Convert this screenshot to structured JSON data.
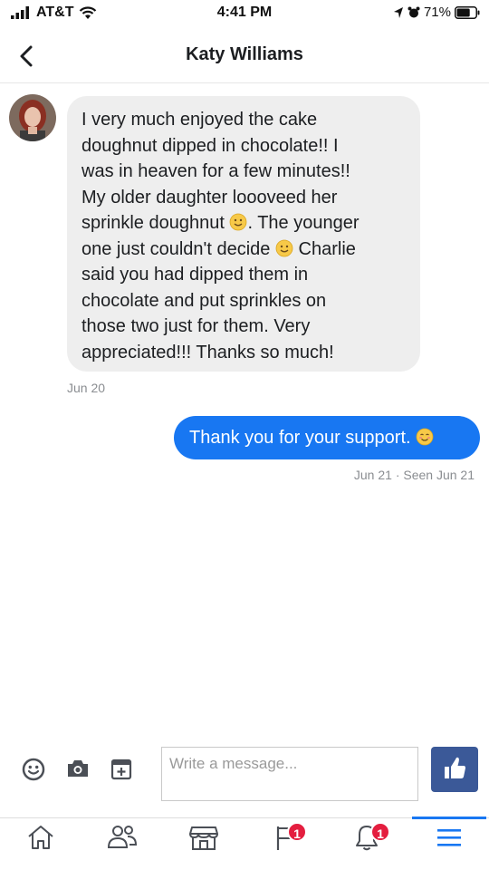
{
  "status_bar": {
    "carrier": "AT&T",
    "time": "4:41 PM",
    "battery_percent": "71%",
    "battery_level": 0.71
  },
  "header": {
    "title": "Katy Williams",
    "back_icon": "chevron-left-icon"
  },
  "conversation": {
    "incoming": {
      "lines_a": [
        "I very much enjoyed the cake",
        "doughnut dipped in chocolate!!  I",
        "was in heaven for a few minutes!!",
        "My older daughter loooveed her"
      ],
      "line5_before_emoji": "sprinkle doughnut ",
      "line5_after_emoji": ".  The younger",
      "line6_before_emoji": "one just couldn't decide ",
      "line6_after_emoji": " Charlie",
      "lines_b": [
        "said you had dipped them in",
        "chocolate and put sprinkles on",
        "those two just for them.  Very",
        "appreciated!!! Thanks so much!"
      ],
      "date": "Jun 20"
    },
    "outgoing": {
      "text": "Thank you for your support. ",
      "meta": "Jun 21 · Seen Jun 21"
    }
  },
  "composer": {
    "placeholder": "Write a message...",
    "icons": [
      "emoji-icon",
      "camera-icon",
      "sticker-icon",
      "thumbs-up-icon"
    ]
  },
  "tab_bar": {
    "tabs": [
      {
        "name": "home-icon",
        "badge": ""
      },
      {
        "name": "friends-icon",
        "badge": ""
      },
      {
        "name": "marketplace-icon",
        "badge": ""
      },
      {
        "name": "pages-flag-icon",
        "badge": "1"
      },
      {
        "name": "notifications-bell-icon",
        "badge": "1"
      },
      {
        "name": "menu-icon",
        "badge": "",
        "active": true
      }
    ]
  },
  "colors": {
    "accent": "#1877f2",
    "incoming_bubble": "#eeeeee",
    "like_button": "#3b5998",
    "badge": "#e41e3f"
  }
}
